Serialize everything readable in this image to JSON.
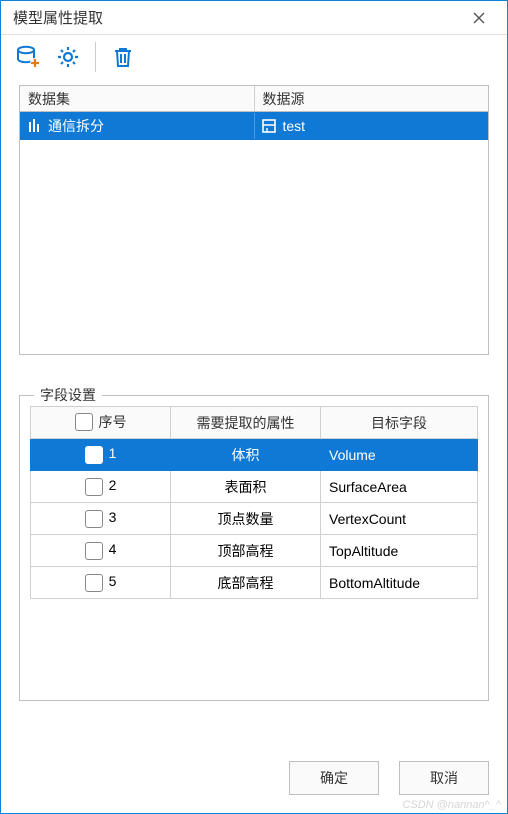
{
  "window": {
    "title": "模型属性提取"
  },
  "datasource": {
    "header_dataset": "数据集",
    "header_source": "数据源",
    "rows": [
      {
        "dataset": "通信拆分",
        "source": "test"
      }
    ]
  },
  "fieldset": {
    "legend": "字段设置",
    "col_index": "序号",
    "col_attr": "需要提取的属性",
    "col_target": "目标字段",
    "rows": [
      {
        "idx": "1",
        "attr": "体积",
        "target": "Volume",
        "checked": true,
        "selected": true
      },
      {
        "idx": "2",
        "attr": "表面积",
        "target": "SurfaceArea",
        "checked": false,
        "selected": false
      },
      {
        "idx": "3",
        "attr": "顶点数量",
        "target": "VertexCount",
        "checked": false,
        "selected": false
      },
      {
        "idx": "4",
        "attr": "顶部高程",
        "target": "TopAltitude",
        "checked": false,
        "selected": false
      },
      {
        "idx": "5",
        "attr": "底部高程",
        "target": "BottomAltitude",
        "checked": false,
        "selected": false
      }
    ]
  },
  "buttons": {
    "ok": "确定",
    "cancel": "取消"
  },
  "watermark": "CSDN @nannan^_^"
}
